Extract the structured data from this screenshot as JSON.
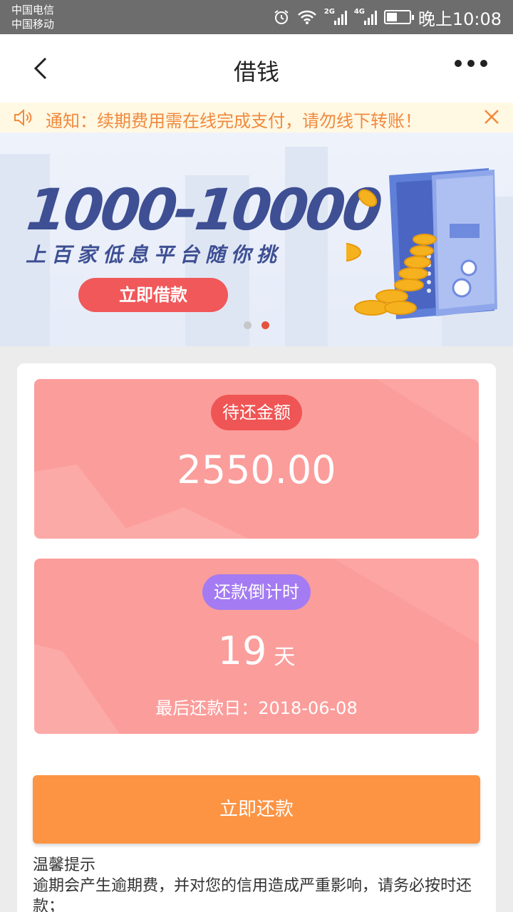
{
  "status_bar": {
    "carrier_1": "中国电信",
    "carrier_2": "中国移动",
    "network_1": "2G",
    "network_2": "4G",
    "time": "晚上10:08"
  },
  "header": {
    "title": "借钱"
  },
  "notice": {
    "text": "通知：续期费用需在线完成支付，请勿线下转账！"
  },
  "banner": {
    "range": "1000-10000",
    "subtitle": "上百家低息平台随你挑",
    "cta_label": "立即借款",
    "slides": 2,
    "active_slide": 2
  },
  "repayment": {
    "amount_label": "待还金额",
    "amount": "2550.00",
    "countdown_label": "还款倒计时",
    "days": "19",
    "days_unit": "天",
    "last_day": "最后还款日：2018-06-08",
    "button_label": "立即还款",
    "tips_title": "温馨提示",
    "tips_body": "逾期会产生逾期费，并对您的信用造成严重影响，请务必按时还款；"
  },
  "colors": {
    "accent_orange": "#fc9444",
    "panel_pink": "#fb9d9b",
    "pill_red": "#ef5554",
    "pill_purple": "#a47bf2",
    "notice_text": "#f08a3e"
  }
}
